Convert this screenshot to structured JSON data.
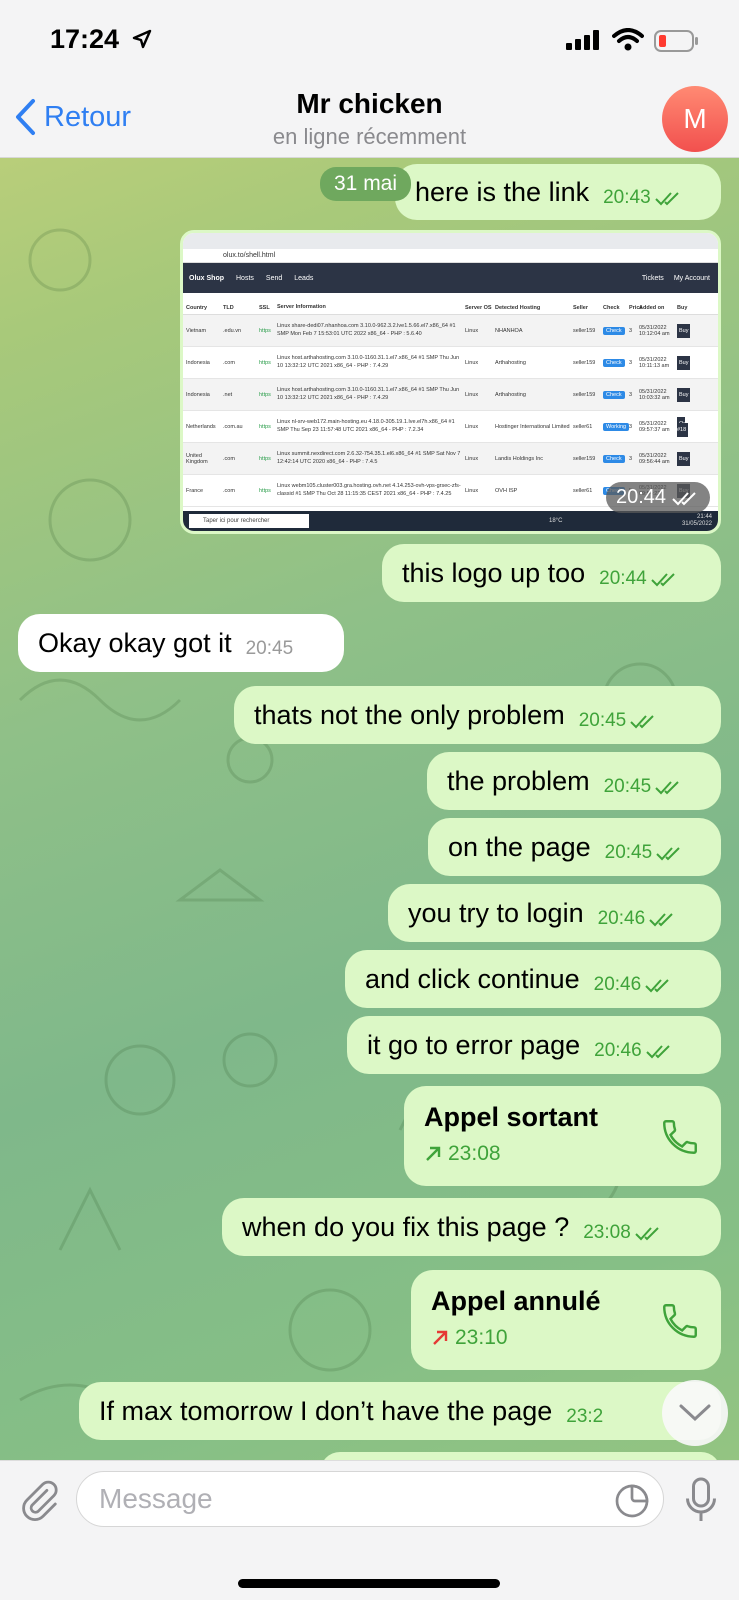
{
  "status": {
    "time": "17:24"
  },
  "header": {
    "back_label": "Retour",
    "title": "Mr chicken",
    "subtitle": "en ligne récemment",
    "avatar_letter": "M"
  },
  "date_chip": "31 mai",
  "messages": [
    {
      "text": "here is the link",
      "time": "20:43",
      "dir": "out"
    },
    {
      "text": "this logo up too",
      "time": "20:44",
      "dir": "out"
    },
    {
      "text": "Okay okay got it",
      "time": "20:45",
      "dir": "in"
    },
    {
      "text": "thats not the only problem",
      "time": "20:45",
      "dir": "out"
    },
    {
      "text": "the problem",
      "time": "20:45",
      "dir": "out"
    },
    {
      "text": "on the page",
      "time": "20:45",
      "dir": "out"
    },
    {
      "text": "you try to login",
      "time": "20:46",
      "dir": "out"
    },
    {
      "text": "and click continue",
      "time": "20:46",
      "dir": "out"
    },
    {
      "text": "it go to error page",
      "time": "20:46",
      "dir": "out"
    },
    {
      "text": "when do you fix this page ?",
      "time": "23:08",
      "dir": "out"
    },
    {
      "text": "If max tomorrow I don’t have the page",
      "time": "23:2",
      "dir": "out"
    }
  ],
  "image_message": {
    "time": "20:44",
    "url": "olux.to/shell.html",
    "site_name": "Olux Shop",
    "nav": [
      "Hosts",
      "Send",
      "Leads"
    ],
    "nav_right": [
      "Tickets",
      "My Account"
    ],
    "columns": [
      "Country",
      "TLD",
      "SSL",
      "Server Information",
      "Server OS",
      "Detected Hosting",
      "Seller",
      "Check",
      "Price",
      "Added on",
      "Buy"
    ],
    "rows": [
      {
        "country": "Vietnam",
        "tld": ".edu.vn",
        "ssl": "https",
        "info": "Linux share-dedi07.nhanhoa.com 3.10.0-962.3.2.lve1.5.66.el7.x86_64 #1 SMP Mon Feb 7 15:53:01 UTC 2022 x86_64 - PHP : 5.6.40",
        "os": "Linux",
        "host": "NHANHOA",
        "seller": "seller159",
        "check": "Check",
        "price": "3",
        "added": "05/31/2022 10:12:04 am",
        "buy": "Buy"
      },
      {
        "country": "Indonesia",
        "tld": ".com",
        "ssl": "https",
        "info": "Linux host.arthahosting.com 3.10.0-1160.31.1.el7.x86_64 #1 SMP Thu Jun 10 13:32:12 UTC 2021 x86_64 - PHP : 7.4.29",
        "os": "Linux",
        "host": "Arthahosting",
        "seller": "seller159",
        "check": "Check",
        "price": "3",
        "added": "05/31/2022 10:11:13 am",
        "buy": "Buy"
      },
      {
        "country": "Indonesia",
        "tld": ".net",
        "ssl": "https",
        "info": "Linux host.arthahosting.com 3.10.0-1160.31.1.el7.x86_64 #1 SMP Thu Jun 10 13:32:12 UTC 2021 x86_64 - PHP : 7.4.29",
        "os": "Linux",
        "host": "Arthahosting",
        "seller": "seller159",
        "check": "Check",
        "price": "3",
        "added": "05/31/2022 10:03:32 am",
        "buy": "Buy"
      },
      {
        "country": "Netherlands",
        "tld": ".com.au",
        "ssl": "https",
        "info": "Linux nl-srv-web172.main-hosting.eu 4.18.0-305.19.1.lve.el7h.x86_64 #1 SMP Thu Sep 23 11:57:48 UTC 2021 x86_64 - PHP : 7.2.34",
        "os": "Linux",
        "host": "Hostinger International Limited",
        "seller": "seller61",
        "check": "Working",
        "price": "3",
        "added": "05/31/2022 09:57:37 am",
        "buy": "Or #18"
      },
      {
        "country": "United Kingdom",
        "tld": ".com",
        "ssl": "https",
        "info": "Linux summit.nexdirect.com 2.6.32-754.35.1.el6.x86_64 #1 SMP Sat Nov 7 12:42:14 UTC 2020 x86_64 - PHP : 7.4.5",
        "os": "Linux",
        "host": "Landis Holdings Inc",
        "seller": "seller159",
        "check": "Check",
        "price": "3",
        "added": "05/31/2022 09:56:44 am",
        "buy": "Buy"
      },
      {
        "country": "France",
        "tld": ".com",
        "ssl": "https",
        "info": "Linux webm105.cluster003.gra.hosting.ovh.net 4.14.253-ovh-vps-grsec-zfs-classid #1 SMP Thu Oct 28 11:15:35 CEST 2021 x86_64 - PHP : 7.4.25",
        "os": "Linux",
        "host": "OVH ISP",
        "seller": "seller61",
        "check": "Check",
        "price": "5",
        "added": "05/31/2022 09:54:22",
        "buy": "Buy"
      }
    ],
    "taskbar_search": "Taper ici pour rechercher",
    "taskbar_temp": "18°C",
    "taskbar_clock": "21:44",
    "taskbar_date": "31/05/2022"
  },
  "calls": [
    {
      "title": "Appel sortant",
      "time": "23:08",
      "arrow_color": "#3fa33a",
      "time_color": "#3fa33a"
    },
    {
      "title": "Appel annulé",
      "time": "23:10",
      "arrow_color": "#e53935",
      "time_color": "#3fa33a"
    }
  ],
  "input": {
    "placeholder": "Message"
  },
  "colors": {
    "accent": "#2f7ff2",
    "out_bubble": "#dcf8c6",
    "time_green": "#3fa33a"
  }
}
